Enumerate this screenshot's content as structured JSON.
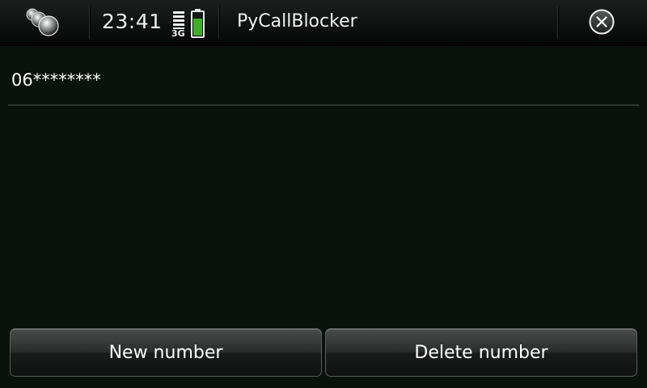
{
  "statusbar": {
    "time": "23:41",
    "network_label": "3G",
    "battery_color": "#3fae2a"
  },
  "titlebar": {
    "app_title": "PyCallBlocker",
    "close_icon": "close-icon"
  },
  "list": {
    "items": [
      {
        "label": "06********"
      }
    ]
  },
  "buttons": {
    "new_number_label": "New number",
    "delete_number_label": "Delete number"
  }
}
